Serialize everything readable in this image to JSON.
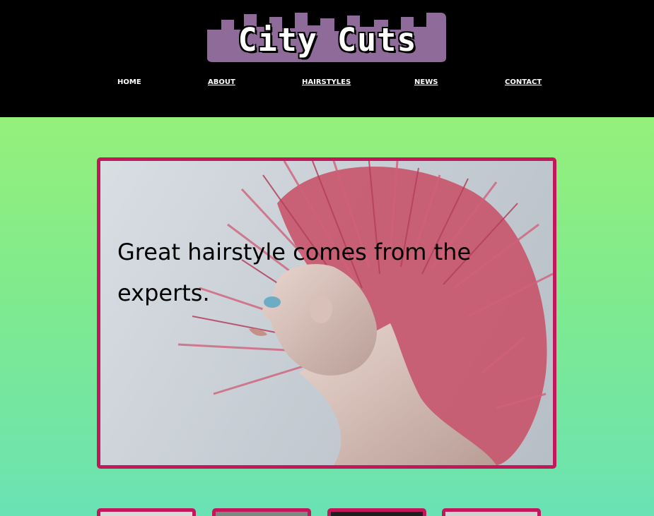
{
  "logo": {
    "text": "City Cuts"
  },
  "nav": {
    "items": [
      {
        "label": "HOME"
      },
      {
        "label": "ABOUT"
      },
      {
        "label": "HAIRSTYLES"
      },
      {
        "label": "NEWS"
      },
      {
        "label": "CONTACT"
      }
    ]
  },
  "hero": {
    "tagline": "Great hairstyle comes from the experts."
  },
  "colors": {
    "header_bg": "#000000",
    "logo_bg": "#8e6b99",
    "accent_border": "#c2185b",
    "page_gradient_top": "#96f07a",
    "page_gradient_bottom": "#6ae2b4"
  }
}
